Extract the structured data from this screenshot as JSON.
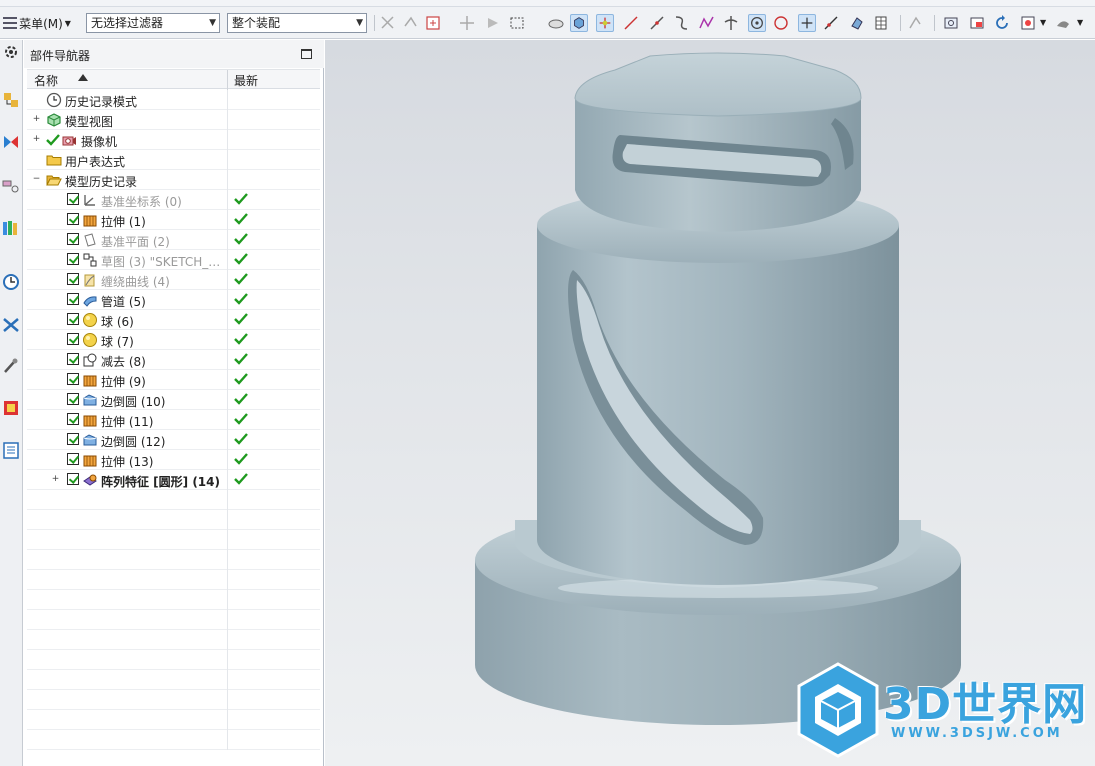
{
  "toolbar": {
    "menu_label": "菜单(M)",
    "filter_value": "无选择过滤器",
    "scope_value": "整个装配"
  },
  "navigator": {
    "title": "部件导航器",
    "columns": {
      "name": "名称",
      "latest": "最新"
    },
    "top_nodes": [
      {
        "label": "历史记录模式",
        "icon": "clock-icon"
      },
      {
        "label": "模型视图",
        "icon": "model-views-icon"
      },
      {
        "label": "摄像机",
        "icon": "camera-icon"
      },
      {
        "label": "用户表达式",
        "icon": "folder-icon"
      },
      {
        "label": "模型历史记录",
        "icon": "folder-open-icon"
      }
    ],
    "features": [
      {
        "label": "基准坐标系 (0)",
        "icon": "datum-csys-icon",
        "dim": true,
        "bold": false
      },
      {
        "label": "拉伸 (1)",
        "icon": "extrude-icon",
        "dim": false,
        "bold": false
      },
      {
        "label": "基准平面 (2)",
        "icon": "datum-plane-icon",
        "dim": true,
        "bold": false
      },
      {
        "label": "草图 (3) \"SKETCH_0...",
        "icon": "sketch-icon",
        "dim": true,
        "bold": false
      },
      {
        "label": "缠绕曲线 (4)",
        "icon": "wrap-curve-icon",
        "dim": true,
        "bold": false
      },
      {
        "label": "管道 (5)",
        "icon": "tube-icon",
        "dim": false,
        "bold": false
      },
      {
        "label": "球 (6)",
        "icon": "sphere-icon",
        "dim": false,
        "bold": false
      },
      {
        "label": "球 (7)",
        "icon": "sphere-icon",
        "dim": false,
        "bold": false
      },
      {
        "label": "减去 (8)",
        "icon": "subtract-icon",
        "dim": false,
        "bold": false
      },
      {
        "label": "拉伸 (9)",
        "icon": "extrude-icon",
        "dim": false,
        "bold": false
      },
      {
        "label": "边倒圆 (10)",
        "icon": "edge-blend-icon",
        "dim": false,
        "bold": false
      },
      {
        "label": "拉伸 (11)",
        "icon": "extrude-icon",
        "dim": false,
        "bold": false
      },
      {
        "label": "边倒圆 (12)",
        "icon": "edge-blend-icon",
        "dim": false,
        "bold": false
      },
      {
        "label": "拉伸 (13)",
        "icon": "extrude-icon",
        "dim": false,
        "bold": false
      },
      {
        "label": "阵列特征 [圆形] (14)",
        "icon": "pattern-feature-icon",
        "dim": false,
        "bold": true
      }
    ]
  },
  "watermark": {
    "brand": "3D世界网",
    "url": "WWW.3DSJW.COM"
  },
  "colors": {
    "accent": "#3aa3de",
    "check_green": "#1f9a1f",
    "model_body": "#9fb3bc"
  }
}
